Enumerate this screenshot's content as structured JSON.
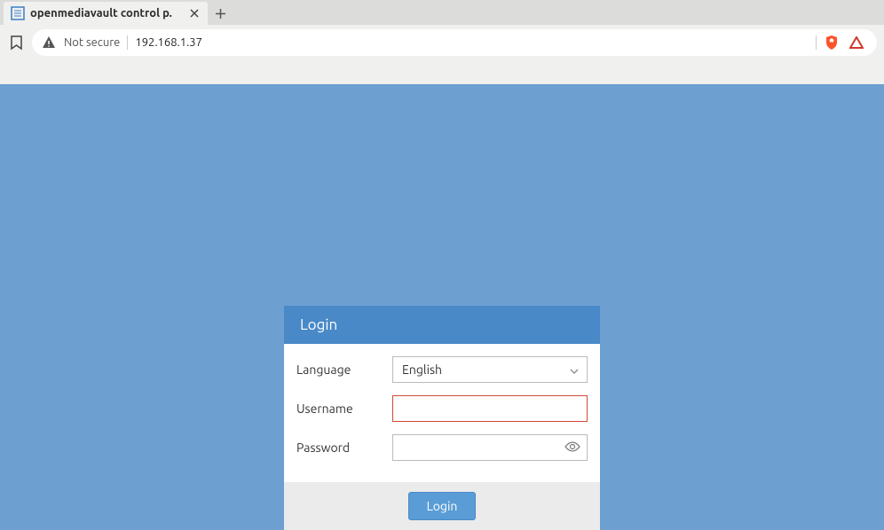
{
  "browser": {
    "tab": {
      "title": "openmediavault control p."
    },
    "security_label": "Not secure",
    "url": "192.168.1.37"
  },
  "login": {
    "header": "Login",
    "labels": {
      "language": "Language",
      "username": "Username",
      "password": "Password"
    },
    "language_value": "English",
    "username_value": "",
    "password_value": "",
    "login_button": "Login"
  }
}
